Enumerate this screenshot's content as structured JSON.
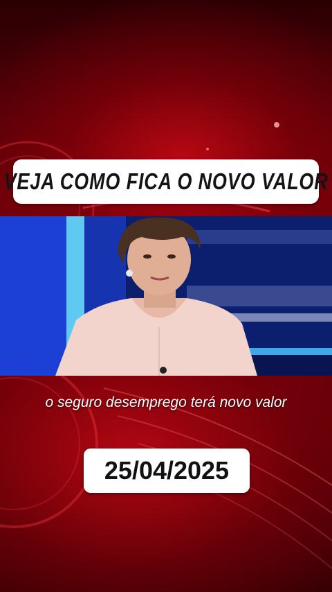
{
  "overlay": {
    "title": "VEJA COMO FICA O NOVO VALOR",
    "caption": "o seguro desemprego terá novo valor",
    "date": "25/04/2025"
  },
  "colors": {
    "background_red": "#8a000e",
    "text_box": "#ffffff",
    "video_blue": "#1b3fd0"
  }
}
